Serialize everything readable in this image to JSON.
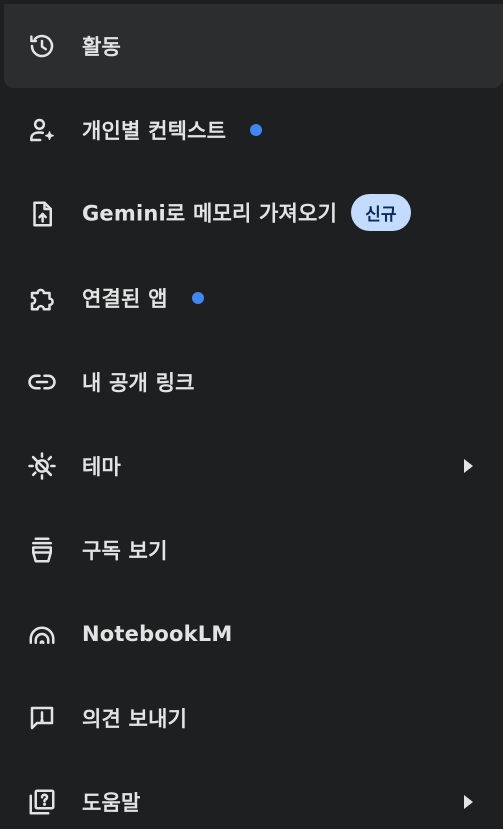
{
  "menu": {
    "items": [
      {
        "label": "활동",
        "icon": "history-icon"
      },
      {
        "label": "개인별 컨텍스트",
        "icon": "person-sparkle-icon",
        "dot_color": "#4285f4"
      },
      {
        "label": "Gemini로 메모리 가져오기",
        "icon": "file-upload-icon",
        "badge": "신규"
      },
      {
        "label": "연결된 앱",
        "icon": "puzzle-piece-icon",
        "dot_color": "#4285f4"
      },
      {
        "label": "내 공개 링크",
        "icon": "link-icon"
      },
      {
        "label": "테마",
        "icon": "theme-sun-icon",
        "has_submenu": true
      },
      {
        "label": "구독 보기",
        "icon": "subscription-icon"
      },
      {
        "label": "NotebookLM",
        "icon": "notebooklm-icon"
      },
      {
        "label": "의견 보내기",
        "icon": "feedback-icon"
      },
      {
        "label": "도움말",
        "icon": "help-icon",
        "has_submenu": true
      }
    ]
  },
  "colors": {
    "background": "#1e1f20",
    "active_background": "#2c2d2f",
    "text": "#e3e3e3",
    "dot": "#4285f4",
    "badge_background": "#c2dbff",
    "badge_text": "#0b2a5c"
  }
}
